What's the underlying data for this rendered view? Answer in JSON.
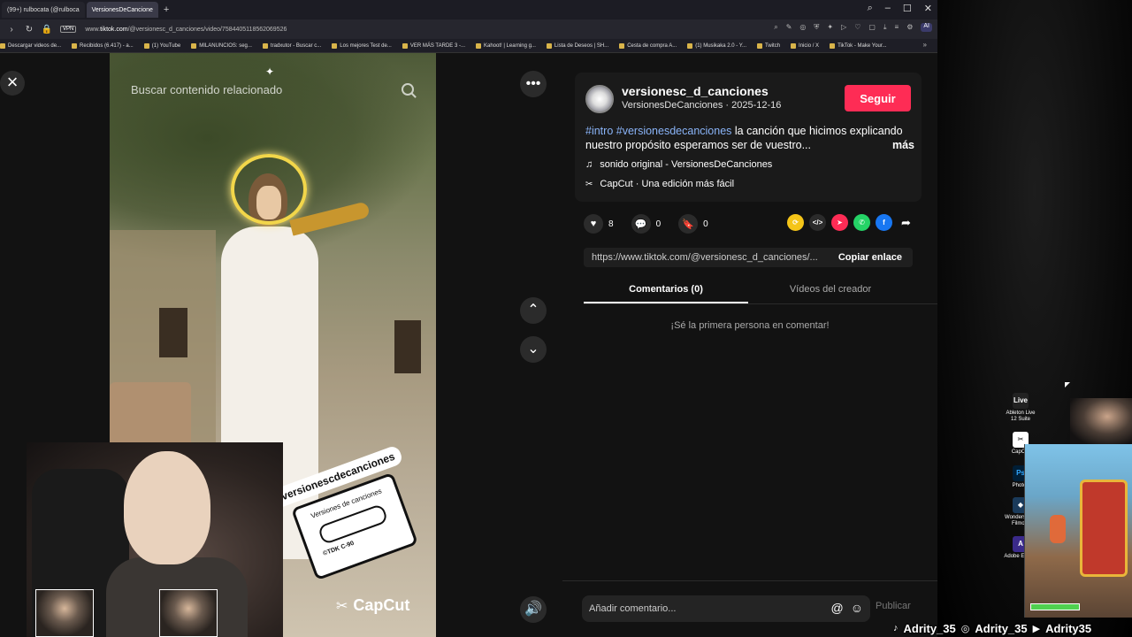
{
  "browser": {
    "tabs": [
      {
        "label": "(99+) rulbocata (@rulboca"
      },
      {
        "label": "VersionesDeCancione"
      }
    ],
    "url_prefix": "www.",
    "url_host": "tiktok.com",
    "url_path": "/@versionesc_d_canciones/video/7584405118562069526",
    "vpn_label": "VPN",
    "ai_label": "AI",
    "bookmarks": [
      "Descargar videos de...",
      "Recibidos (6.417) - a...",
      "(1) YouTube",
      "MILANUNCIOS: seg...",
      "tradxutor - Buscar c...",
      "Los mejores Test de...",
      "VER MÁS TARDE 3 -...",
      "Kahoot! | Learning g...",
      "Lista de Deseos | SH...",
      "Cesta de compra A...",
      "(1) Musikaka 2.0 - Y...",
      "Twitch",
      "Inicio / X",
      "TikTok - Make Your..."
    ]
  },
  "video": {
    "search_placeholder": "Buscar contenido relacionado",
    "sticker_handle": "versionescdecanciones",
    "cassette_label": "Versiones de canciones",
    "cassette_brand": "©TDK  C-90",
    "watermark": "CapCut"
  },
  "post": {
    "author_name": "versionesc_d_canciones",
    "author_sub": "VersionesDeCanciones · 2025-12-16",
    "follow_label": "Seguir",
    "hashtag1": "#intro",
    "hashtag2": "#versionesdecanciones",
    "description": " la canción que hicimos explicando nuestro propósito esperamos ser de vuestro...",
    "more_label": "más",
    "music": "sonido original - VersionesDeCanciones",
    "capcut": "CapCut · Una edición más fácil",
    "likes": "8",
    "comments": "0",
    "saves": "0",
    "share_link": "https://www.tiktok.com/@versionesc_d_canciones/...",
    "copy_label": "Copiar enlace"
  },
  "panel_tabs": {
    "comments": "Comentarios (0)",
    "creator_videos": "Vídeos del creador"
  },
  "comments": {
    "empty_text": "¡Sé la primera persona en comentar!",
    "input_placeholder": "Añadir comentario...",
    "publish_label": "Publicar"
  },
  "desktop": {
    "icons": [
      {
        "label": "Ableton Live 12 Suite",
        "short": "Live"
      },
      {
        "label": "CapCut",
        "short": "✂"
      },
      {
        "label": "Photos",
        "short": "Ps"
      },
      {
        "label": "Wondershare Filmora",
        "short": "◆"
      },
      {
        "label": "Adobe Effects",
        "short": "A"
      }
    ]
  },
  "socials": {
    "tiktok": "Adrity_35",
    "instagram": "Adrity_35",
    "youtube": "Adrity35"
  },
  "colors": {
    "follow": "#fe2c55",
    "hashtag": "#8ab4f8",
    "background": "#121212"
  }
}
